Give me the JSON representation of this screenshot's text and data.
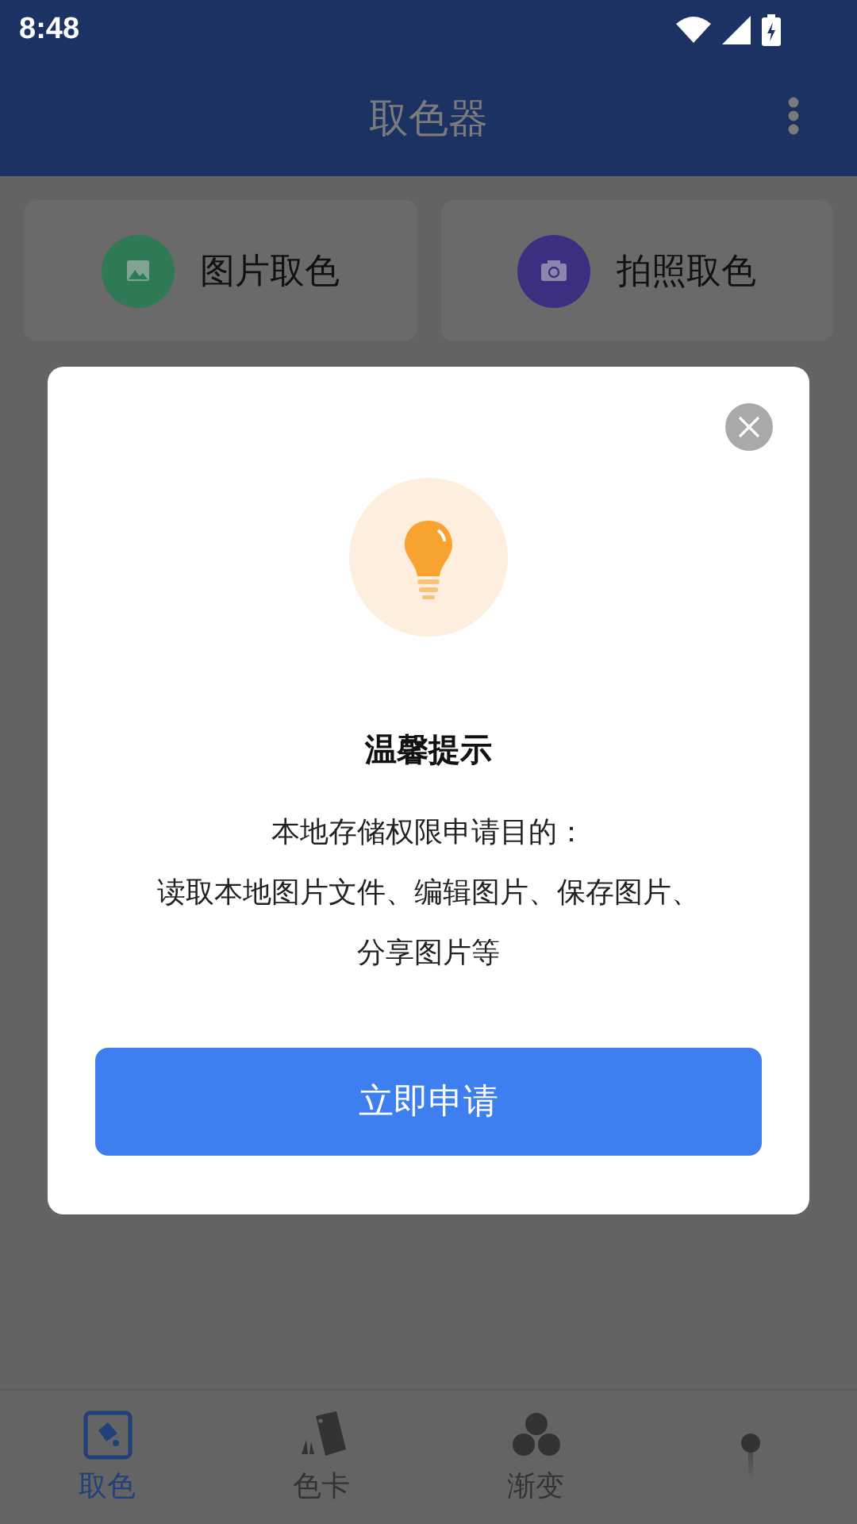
{
  "status_bar": {
    "time": "8:48"
  },
  "app_bar": {
    "title": "取色器"
  },
  "actions": [
    {
      "label": "图片取色",
      "kind": "image",
      "color": "#2e7a55"
    },
    {
      "label": "拍照取色",
      "kind": "camera",
      "color": "#3a2f80"
    }
  ],
  "dialog": {
    "title": "温馨提示",
    "lines": [
      "本地存储权限申请目的：",
      "读取本地图片文件、编辑图片、保存图片、",
      "分享图片等"
    ],
    "button": "立即申请"
  },
  "bottom_nav": [
    {
      "label": "取色",
      "kind": "pick",
      "selected": true
    },
    {
      "label": "色卡",
      "kind": "card",
      "selected": false
    },
    {
      "label": "渐变",
      "kind": "gradient",
      "selected": false
    },
    {
      "kind": "pin",
      "selected": false
    }
  ]
}
